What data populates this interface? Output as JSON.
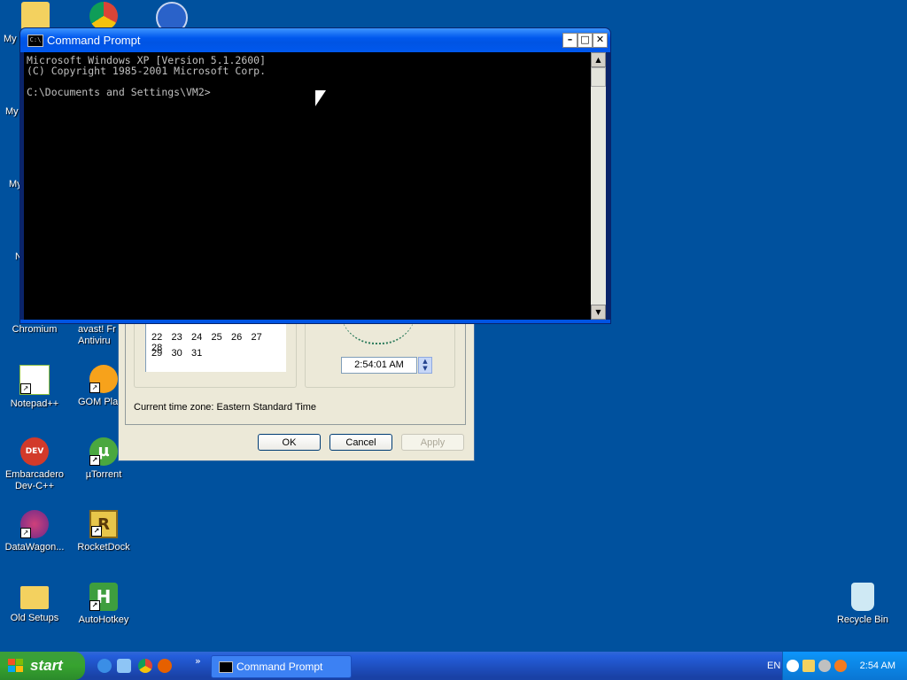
{
  "desktop": {
    "icons": [
      {
        "label": "My",
        "color": "#f3d15f"
      },
      {
        "label": "My",
        "color": "#f3d15f"
      },
      {
        "label": "My",
        "color": "#f3d15f"
      },
      {
        "label": "N",
        "color": "#f3d15f"
      },
      {
        "label": "Chromium",
        "color": "#4a8af4"
      },
      {
        "label": "avast! Fr\nAntiviru",
        "color": "#f47b20"
      },
      {
        "label": "Notepad++",
        "color": "#8bbf3f"
      },
      {
        "label": "GOM Play",
        "color": "#f7a21b"
      },
      {
        "label": "Embarcadero\nDev-C++",
        "color": "#d23a2a"
      },
      {
        "label": "µTorrent",
        "color": "#4aa83f"
      },
      {
        "label": "DataWagon...",
        "color": "#a33a8a"
      },
      {
        "label": "RocketDock",
        "color": "#e8c64a"
      },
      {
        "label": "Old Setups",
        "color": "#f3d15f"
      },
      {
        "label": "AutoHotkey",
        "color": "#3e9e3e"
      },
      {
        "label": "Recycle Bin",
        "color": "#7ec7e6"
      }
    ]
  },
  "datetime": {
    "calendar_rows": [
      [
        "22",
        "23",
        "24",
        "25",
        "26",
        "27",
        "28"
      ],
      [
        "29",
        "30",
        "31"
      ]
    ],
    "time_value": "2:54:01 AM",
    "timezone_text": "Current time zone:  Eastern Standard Time",
    "ok_label": "OK",
    "cancel_label": "Cancel",
    "apply_label": "Apply"
  },
  "cmd": {
    "title": "Command Prompt",
    "icon_text": "C:\\",
    "console_lines": [
      "Microsoft Windows XP [Version 5.1.2600]",
      "(C) Copyright 1985-2001 Microsoft Corp.",
      "",
      "C:\\Documents and Settings\\VM2>"
    ]
  },
  "taskbar": {
    "start_label": "start",
    "task_label": "Command Prompt",
    "quicklaunch_more": "»",
    "lang": "EN",
    "clock": "2:54 AM"
  }
}
